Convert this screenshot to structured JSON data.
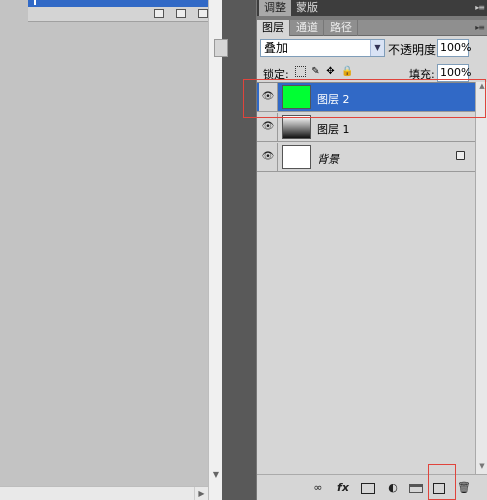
{
  "panel": {
    "tabs_top": [
      "调整",
      "蒙版"
    ],
    "tabs_layers": [
      "图层",
      "通道",
      "路径"
    ],
    "blend_mode": "叠加",
    "opacity_label": "不透明度:",
    "opacity_value": "100%",
    "lock_label": "锁定:",
    "fill_label": "填充:",
    "fill_value": "100%"
  },
  "layers": [
    {
      "name": "图层 2",
      "selected": true,
      "thumb_color": "#00ff33"
    },
    {
      "name": "图层 1",
      "selected": false,
      "thumb_color": "#222222"
    },
    {
      "name": "背景",
      "selected": false,
      "thumb_color": "#ffffff",
      "locked": true
    }
  ],
  "colors": {
    "selection": "#3169c6",
    "highlight_box": "#e0443c",
    "panel_bg": "#d6d6d6"
  },
  "icons": [
    "eye-icon",
    "link-layers-icon",
    "fx-icon",
    "mask-icon",
    "adjustment-icon",
    "group-icon",
    "new-layer-icon",
    "delete-icon"
  ]
}
